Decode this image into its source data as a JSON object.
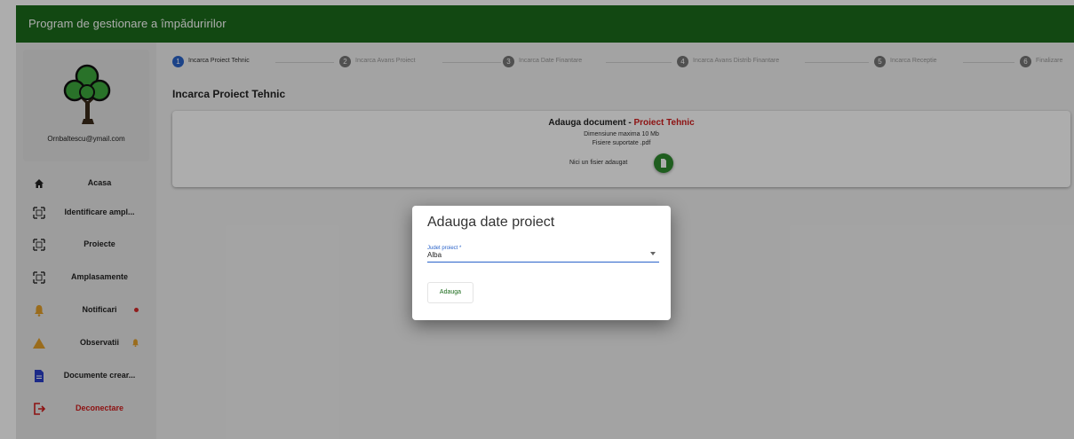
{
  "app": {
    "title": "Program de gestionare a împăduririlor"
  },
  "sidebar": {
    "email": "Ornbaltescu@ymail.com",
    "items": [
      {
        "label": "Acasa",
        "icon": "home-icon"
      },
      {
        "label": "Identificare ampl...",
        "icon": "frame-icon"
      },
      {
        "label": "Proiecte",
        "icon": "frame-icon"
      },
      {
        "label": "Amplasamente",
        "icon": "frame-icon"
      },
      {
        "label": "Notificari",
        "icon": "bell-icon"
      },
      {
        "label": "Observatii",
        "icon": "warning-icon"
      },
      {
        "label": "Documente crear...",
        "icon": "document-icon"
      },
      {
        "label": "Deconectare",
        "icon": "logout-icon"
      }
    ]
  },
  "stepper": {
    "steps": [
      {
        "num": "1",
        "label": "Incarca Proiect Tehnic",
        "active": true
      },
      {
        "num": "2",
        "label": "Incarca Avans Proiect",
        "active": false
      },
      {
        "num": "3",
        "label": "Incarca Date Finantare",
        "active": false
      },
      {
        "num": "4",
        "label": "Incarca Avans Distrib Finantare",
        "active": false
      },
      {
        "num": "5",
        "label": "Incarca Receptie",
        "active": false
      },
      {
        "num": "6",
        "label": "Finalizare",
        "active": false
      }
    ]
  },
  "main": {
    "section_title": "Incarca Proiect Tehnic",
    "upload": {
      "heading": "Adauga document - ",
      "heading_highlight": "Proiect Tehnic",
      "max_size": "Dimensiune maxima 10 Mb",
      "supported": "Fisiere suportate .pdf",
      "status": "Nici un fisier adaugat"
    }
  },
  "dialog": {
    "title": "Adauga date proiect",
    "field_label": "Judet proiect *",
    "field_value": "Alba",
    "button_label": "Adauga"
  },
  "colors": {
    "brand_green": "#1b6b1b",
    "active_step": "#2a63c9",
    "highlight_red": "#d01b1b",
    "notification_dot": "#d42a2a",
    "warning_orange": "#e3a02a"
  }
}
